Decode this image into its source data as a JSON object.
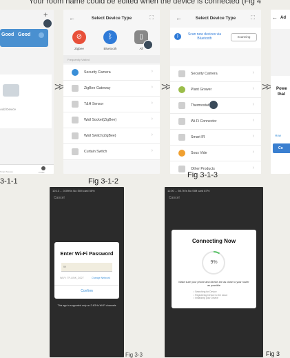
{
  "header_text": "Your room name could be edited when the device is connected (Fig 4",
  "captions": {
    "fig1": "3-1-1",
    "fig2": "Fig 3-1-2",
    "fig3": "Fig 3-1-3",
    "fig4": "Fig 3"
  },
  "home": {
    "tile1": "Good",
    "tile2": "Good",
    "add_device": "Add Device",
    "nav_left": "Smart Scenes",
    "nav_right": "Profile"
  },
  "select_device_2": {
    "title": "Select Device Type",
    "icons": [
      "Zigbee",
      "Bluetooth",
      "All"
    ],
    "section_header": "Frequently Visited",
    "items": [
      "Security Camera",
      "ZigBee Gateway",
      "T&H Sensor",
      "Wall Socket(ZigBee)",
      "Wall Switch(ZigBee)",
      "Curtain Switch"
    ]
  },
  "select_device_3": {
    "title": "Select Device Type",
    "scan_text": "Scan new devices via Bluetooth",
    "scan_button": "Scanning",
    "items": [
      "Security Camera",
      "Plant Grower",
      "Thermostat",
      "Wi-Fi Connector",
      "Smart IR",
      "Sous Vide",
      "Other Products"
    ]
  },
  "add_panel": {
    "title_fragment": "Ad",
    "text_fragment1": "Powe",
    "text_fragment2": "that",
    "link_fragment": "How",
    "button_fragment": "Co"
  },
  "wifi_screen": {
    "status": "10:13 ... 0.09K/s   No SIM card  55%",
    "cancel": "Cancel",
    "title": "Enter Wi-Fi Password",
    "password": "W",
    "network": "Wi-Fi: TP-LINK_D327",
    "change_network": "Change Network",
    "confirm": "Confirm",
    "note": "This app is supported only on 2.4GHz Wi-Fi channels"
  },
  "connecting_screen": {
    "status": "11:00 ... 98.7K/s   No SIM card  87%",
    "cancel": "Cancel",
    "title": "Connecting Now",
    "percent": "9%",
    "note": "Make sure your phone and device are as close to your router as possible",
    "steps": [
      "Searching for Device",
      "Registering Device to the cloud",
      "Initializing your Device"
    ]
  },
  "fig_right_bottom": "Fig 3"
}
